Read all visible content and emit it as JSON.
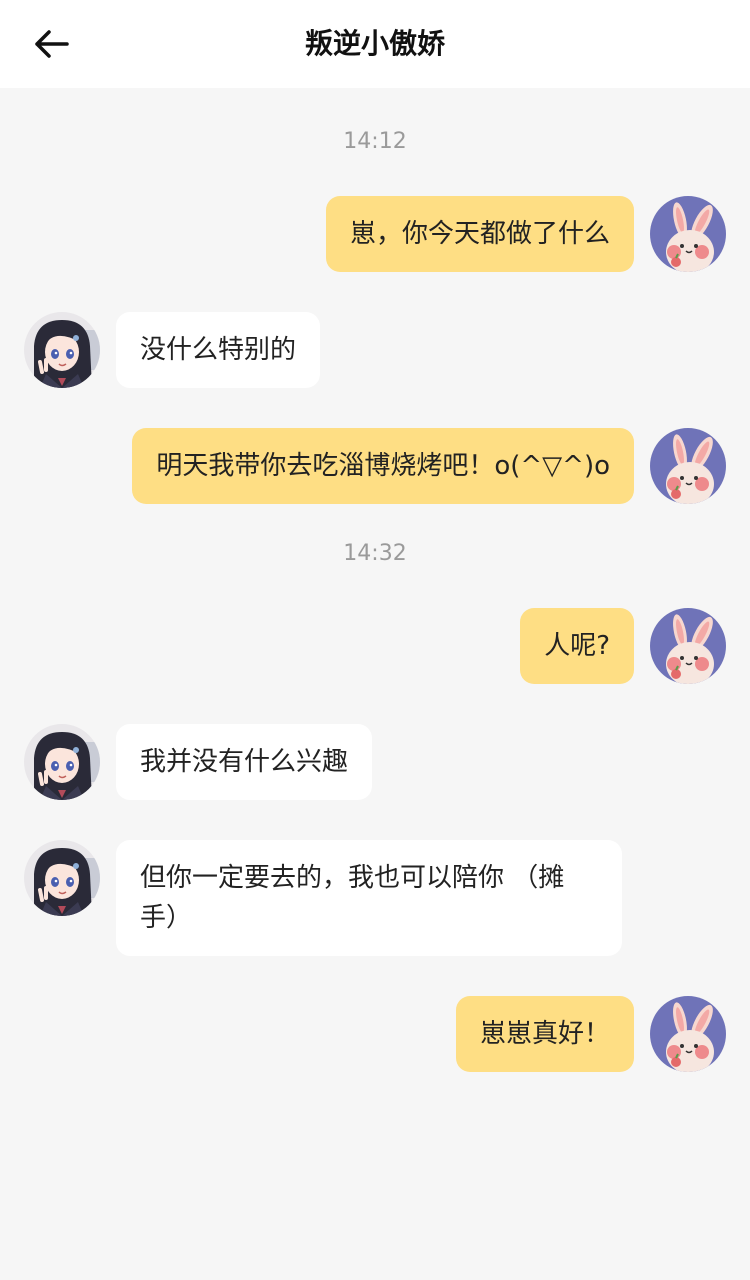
{
  "header": {
    "title": "叛逆小傲娇",
    "back_icon": "arrow-left-icon"
  },
  "colors": {
    "my_bubble": "#fede84",
    "their_bubble": "#ffffff",
    "background": "#f6f6f6",
    "timestamp": "#9a9a9a"
  },
  "timestamps": [
    "14:12",
    "14:32"
  ],
  "messages": [
    {
      "sender": "me",
      "avatar": "rabbit-avatar",
      "text": "崽，你今天都做了什么"
    },
    {
      "sender": "them",
      "avatar": "anime-girl-avatar",
      "text": "没什么特别的"
    },
    {
      "sender": "me",
      "avatar": "rabbit-avatar",
      "text": "明天我带你去吃淄博烧烤吧！o(^▽^)o"
    },
    {
      "sender": "me",
      "avatar": "rabbit-avatar",
      "text": "人呢?"
    },
    {
      "sender": "them",
      "avatar": "anime-girl-avatar",
      "text": "我并没有什么兴趣"
    },
    {
      "sender": "them",
      "avatar": "anime-girl-avatar",
      "text": "但你一定要去的，我也可以陪你 （摊手）"
    },
    {
      "sender": "me",
      "avatar": "rabbit-avatar",
      "text": "崽崽真好！"
    }
  ]
}
